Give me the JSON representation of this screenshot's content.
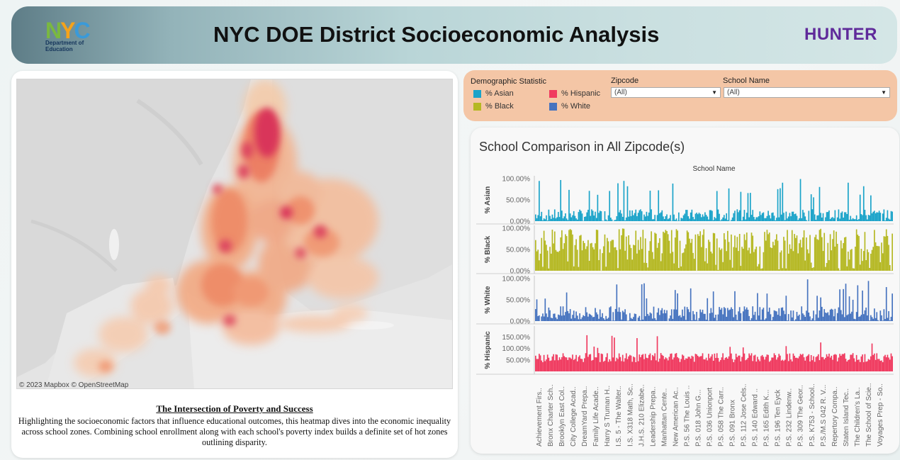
{
  "header": {
    "logo_text": "NYC",
    "logo_subtitle_line1": "Department of",
    "logo_subtitle_line2": "Education",
    "title": "NYC DOE District Socioeconomic Analysis",
    "brand": "HUNTER"
  },
  "map": {
    "attribution": "© 2023 Mapbox  © OpenStreetMap",
    "heading": "The Intersection of Poverty and Success",
    "body": "Highlighting the socioeconomic factors that influence educational outcomes, this heatmap dives into the economic inequality across school zones. Combining school enrollment along with each school's poverty index builds a definite set of hot zones outlining disparity."
  },
  "filters": {
    "legend_title": "Demographic Statistic",
    "legend": [
      {
        "label": "% Asian",
        "color": "#1aa3c9"
      },
      {
        "label": "% Hispanic",
        "color": "#f03a5f"
      },
      {
        "label": "% Black",
        "color": "#b5b823"
      },
      {
        "label": "% White",
        "color": "#4673bf"
      }
    ],
    "zipcode_label": "Zipcode",
    "zipcode_value": "(All)",
    "school_label": "School Name",
    "school_value": "(All)"
  },
  "chart_title": "School Comparison in All Zipcode(s)",
  "chart_data": {
    "type": "bar",
    "column_header": "School Name",
    "panels": [
      {
        "name": "% Asian",
        "color": "#1aa3c9",
        "ticks": [
          "100.00%",
          "50.00%",
          "0.00%"
        ],
        "ylim": [
          0,
          100
        ]
      },
      {
        "name": "% Black",
        "color": "#b5b823",
        "ticks": [
          "100.00%",
          "50.00%",
          "0.00%"
        ],
        "ylim": [
          0,
          100
        ]
      },
      {
        "name": "% White",
        "color": "#4673bf",
        "ticks": [
          "100.00%",
          "50.00%",
          "0.00%"
        ],
        "ylim": [
          0,
          100
        ]
      },
      {
        "name": "% Hispanic",
        "color": "#f03a5f",
        "ticks": [
          "150.00%",
          "100.00%",
          "50.00%"
        ],
        "ylim": [
          0,
          185
        ]
      }
    ],
    "categories": [
      "Achievement Firs..",
      "Bronx Charter Sch..",
      "Brooklyn East Col..",
      "City College Acad..",
      "DreamYard Prepa..",
      "Family Life Acade..",
      "Harry S Truman H..",
      "I.S. 5 - The Walter..",
      "I.S. X318 Math, Sc..",
      "J.H.S. 210 Elizabe..",
      "Leadership Prepa..",
      "Manhattan Cente..",
      "New American Ac..",
      "P.S. 56 The Louis ..",
      "P.S. 018 John G...",
      "P.S. 036 Unionport",
      "P.S. 058 The Carr..",
      "P.S. 091 Bronx",
      "P.S. 112 Jose Cels..",
      "P.S. 140 Edward ..",
      "P.S. 165 Edith K...",
      "P.S. 196 Ten Eyck",
      "P.S. 232 Lindenw..",
      "P.S. 309 The Geor..",
      "P.S. K753 - School..",
      "P.S./M.S 042 R. V...",
      "Repertory Compa..",
      "Staten Island Tec..",
      "The Children's La..",
      "The School of Scie..",
      "Voyages Prep - So.."
    ]
  }
}
